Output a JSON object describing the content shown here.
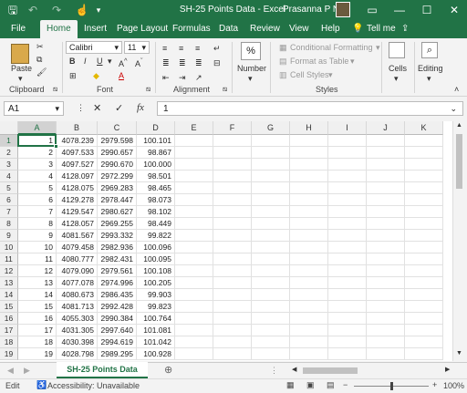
{
  "titlebar": {
    "title": "SH-25 Points Data  -  Excel",
    "user": "Prasanna P N",
    "minimize": "—",
    "restore": "☐",
    "close": "✕"
  },
  "tabs": [
    "File",
    "Home",
    "Insert",
    "Page Layout",
    "Formulas",
    "Data",
    "Review",
    "View",
    "Help",
    "Tell me"
  ],
  "ribbon": {
    "paste": "Paste",
    "clipboard": "Clipboard",
    "font_name": "Calibri",
    "font_size": "11",
    "font": "Font",
    "alignment": "Alignment",
    "number": "Number",
    "percent": "%",
    "conditional": "Conditional Formatting",
    "format_table": "Format as Table",
    "cell_styles": "Cell Styles",
    "styles": "Styles",
    "cells": "Cells",
    "editing": "Editing"
  },
  "formula_bar": {
    "name_box": "A1",
    "fx": "fx",
    "value": "1"
  },
  "columns": [
    "A",
    "B",
    "C",
    "D",
    "E",
    "F",
    "G",
    "H",
    "I",
    "J",
    "K"
  ],
  "rows": [
    [
      "1",
      "4078.239",
      "2979.598",
      "100.101"
    ],
    [
      "2",
      "4097.533",
      "2990.657",
      "98.867"
    ],
    [
      "3",
      "4097.527",
      "2990.670",
      "100.000"
    ],
    [
      "4",
      "4128.097",
      "2972.299",
      "98.501"
    ],
    [
      "5",
      "4128.075",
      "2969.283",
      "98.465"
    ],
    [
      "6",
      "4129.278",
      "2978.447",
      "98.073"
    ],
    [
      "7",
      "4129.547",
      "2980.627",
      "98.102"
    ],
    [
      "8",
      "4128.057",
      "2969.255",
      "98.449"
    ],
    [
      "9",
      "4081.567",
      "2993.332",
      "99.822"
    ],
    [
      "10",
      "4079.458",
      "2982.936",
      "100.096"
    ],
    [
      "11",
      "4080.777",
      "2982.431",
      "100.095"
    ],
    [
      "12",
      "4079.090",
      "2979.561",
      "100.108"
    ],
    [
      "13",
      "4077.078",
      "2974.996",
      "100.205"
    ],
    [
      "14",
      "4080.673",
      "2986.435",
      "99.903"
    ],
    [
      "15",
      "4081.713",
      "2992.428",
      "99.823"
    ],
    [
      "16",
      "4055.303",
      "2990.384",
      "100.764"
    ],
    [
      "17",
      "4031.305",
      "2997.640",
      "101.081"
    ],
    [
      "18",
      "4030.398",
      "2994.619",
      "101.042"
    ],
    [
      "19",
      "4028.798",
      "2989.295",
      "100.928"
    ]
  ],
  "sheet_tab": "SH-25 Points Data",
  "status": {
    "mode": "Edit",
    "accessibility": "Accessibility: Unavailable",
    "zoom": "100%"
  }
}
